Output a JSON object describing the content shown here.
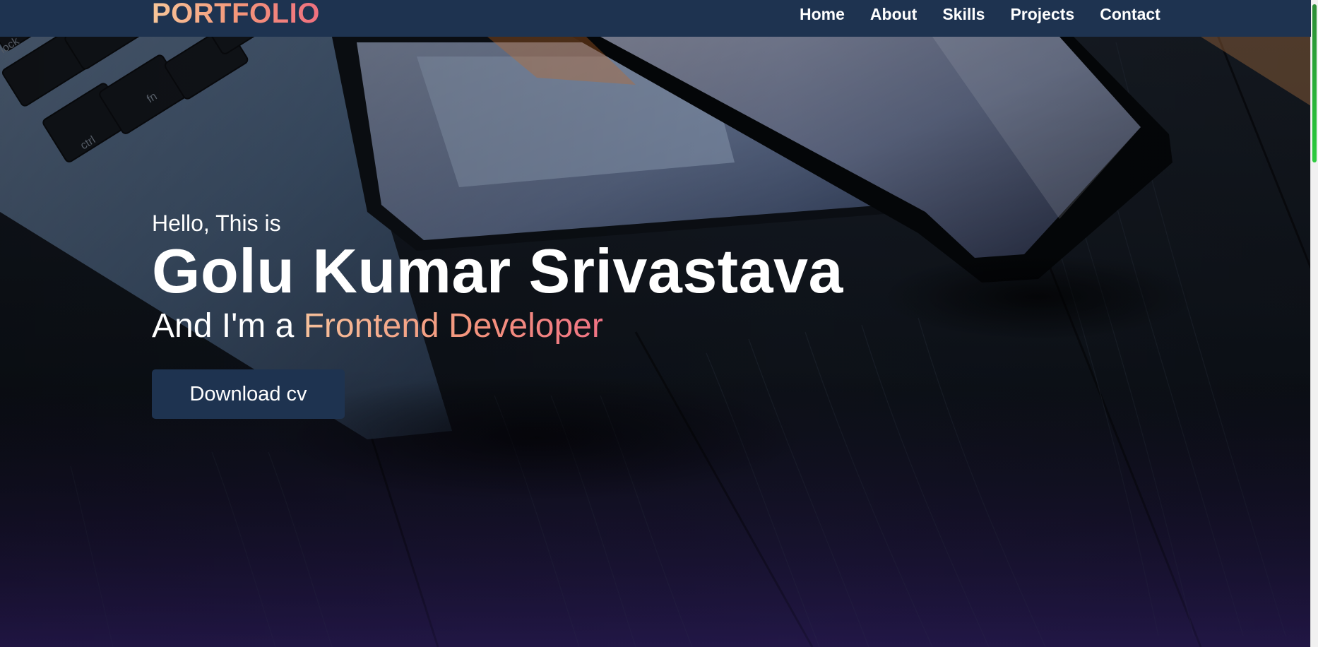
{
  "navbar": {
    "brand": "PORTFOLIO",
    "links": [
      {
        "label": "Home"
      },
      {
        "label": "About"
      },
      {
        "label": "Skills"
      },
      {
        "label": "Projects"
      },
      {
        "label": "Contact"
      }
    ]
  },
  "hero": {
    "greeting": "Hello, This is",
    "name": "Golu Kumar Srivastava",
    "role_prefix": "And I'm a ",
    "role_highlight": "Frontend Developer",
    "cta_label": "Download cv"
  },
  "background_keys": {
    "key_1": "ctrl",
    "key_2": "fn",
    "key_3": "lock"
  },
  "colors": {
    "navbar_bg": "#1e3350",
    "accent_gradient_start": "#f7c69a",
    "accent_gradient_end": "#f0707f",
    "button_bg": "#1e3350",
    "scrollbar_thumb": "#29c43b"
  }
}
